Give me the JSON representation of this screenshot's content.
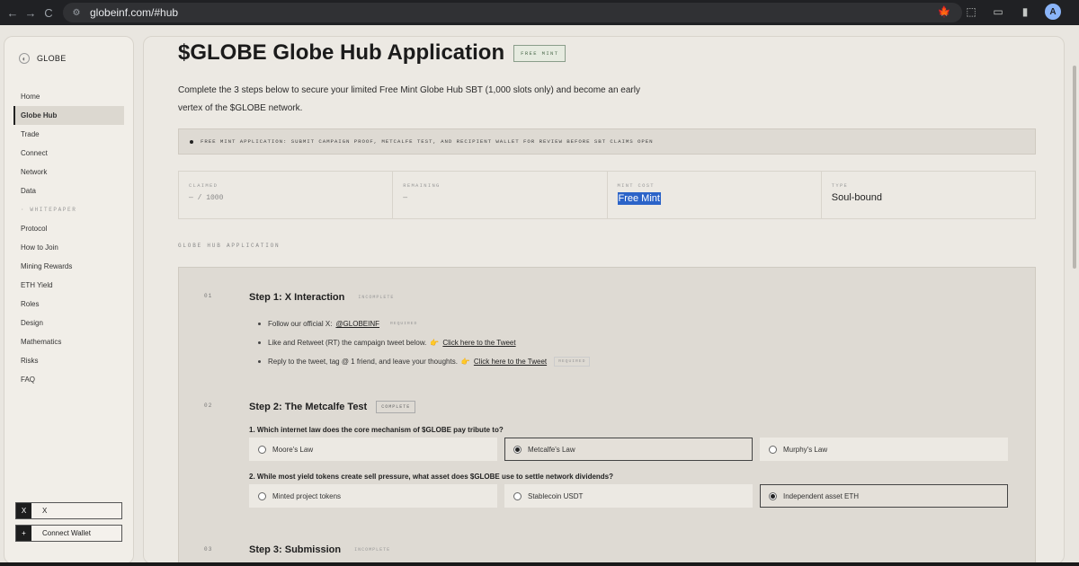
{
  "browser": {
    "url": "globeinf.com/#hub",
    "back_icon": "←",
    "forward_icon": "→",
    "reload_icon": "C",
    "site_icon": "⚙",
    "star_icon": "☆",
    "extension_icons": [
      "🍁",
      "⬚",
      "▭",
      "▮"
    ],
    "avatar": "A"
  },
  "sidebar": {
    "brand": "GLOBE",
    "items": [
      {
        "label": "Home",
        "active": false
      },
      {
        "label": "Globe Hub",
        "active": true
      },
      {
        "label": "Trade",
        "active": false
      },
      {
        "label": "Connect",
        "active": false
      },
      {
        "label": "Network",
        "active": false
      },
      {
        "label": "Data",
        "active": false
      }
    ],
    "section": "· WHITEPAPER",
    "wp_items": [
      "Protocol",
      "How to Join",
      "Mining Rewards",
      "ETH Yield",
      "Roles",
      "Design",
      "Mathematics",
      "Risks",
      "FAQ"
    ],
    "x_button": {
      "icon": "X",
      "label": "X"
    },
    "wallet_button": {
      "icon": "+",
      "label": "Connect Wallet"
    }
  },
  "main": {
    "title": "$GLOBE Globe Hub Application",
    "badge": "FREE MINT",
    "intro": "Complete the 3 steps below to secure your limited Free Mint Globe Hub SBT (1,000 slots only) and become an early vertex of the $GLOBE network.",
    "notice": "FREE MINT APPLICATION: SUBMIT CAMPAIGN PROOF, METCALFE TEST, AND RECIPIENT WALLET FOR REVIEW BEFORE SBT CLAIMS OPEN",
    "stats": [
      {
        "label": "CLAIMED",
        "value": "— / 1000"
      },
      {
        "label": "REMAINING",
        "value": "—"
      },
      {
        "label": "MINT COST",
        "value": "Free Mint"
      },
      {
        "label": "TYPE",
        "value": "Soul-bound"
      }
    ],
    "section_label": "GLOBE HUB APPLICATION",
    "step1": {
      "num": "01",
      "title": "Step 1: X Interaction",
      "status": "INCOMPLETE",
      "b1_text": "Follow our official X:",
      "b1_link": "@GLOBEINF",
      "b1_req": "REQUIRED",
      "b2_text": "Like and Retweet (RT) the campaign tweet below.",
      "b2_link": "Click here to the Tweet",
      "b3_text": "Reply to the tweet, tag @ 1 friend, and leave your thoughts.",
      "b3_link": "Click here to the Tweet",
      "b3_req": "REQUIRED",
      "hand": "👉"
    },
    "step2": {
      "num": "02",
      "title": "Step 2: The Metcalfe Test",
      "status": "COMPLETE",
      "q1": "1. Which internet law does the core mechanism of $GLOBE pay tribute to?",
      "q1_opts": [
        "Moore's Law",
        "Metcalfe's Law",
        "Murphy's Law"
      ],
      "q1_selected": 1,
      "q2": "2. While most yield tokens create sell pressure, what asset does $GLOBE use to settle network dividends?",
      "q2_opts": [
        "Minted project tokens",
        "Stablecoin USDT",
        "Independent asset ETH"
      ],
      "q2_selected": 2
    },
    "step3": {
      "num": "03",
      "title": "Step 3: Submission",
      "status": "INCOMPLETE"
    }
  }
}
